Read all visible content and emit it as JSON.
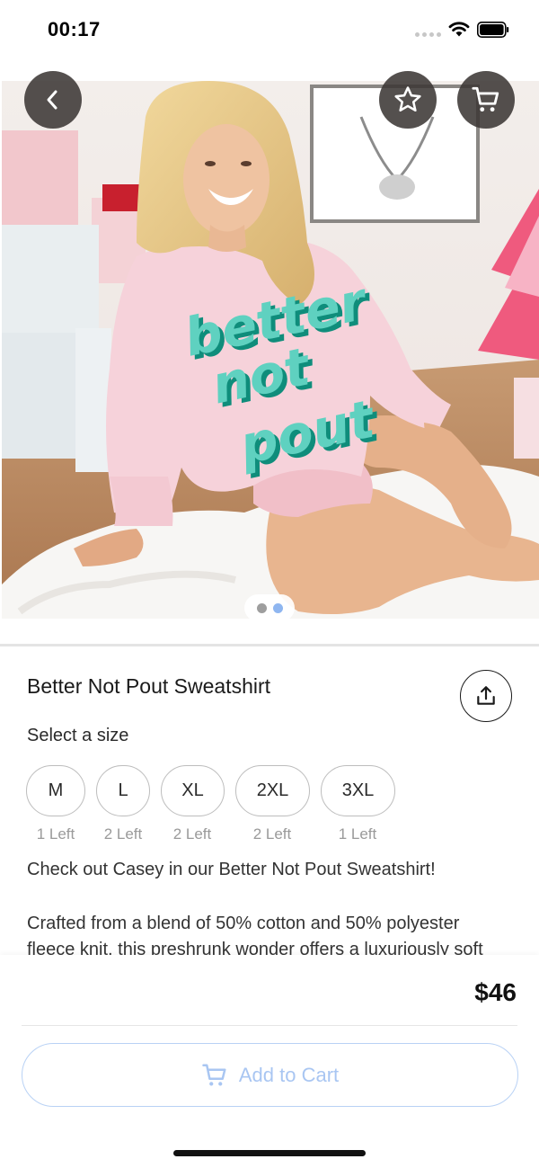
{
  "status_bar": {
    "time": "00:17",
    "wifi_icon": "wifi-icon",
    "battery_icon": "battery-icon"
  },
  "header": {
    "back_icon": "chevron-left-icon",
    "favorite_icon": "star-icon",
    "cart_icon": "cart-icon",
    "button_bg": "#3c3836"
  },
  "gallery": {
    "shirt_text": [
      "better",
      "not",
      "pout"
    ],
    "pages": 2,
    "active_page": 2
  },
  "product": {
    "title": "Better Not Pout Sweatshirt",
    "share_icon": "share-icon",
    "size_label": "Select a size",
    "sizes": [
      {
        "label": "M",
        "stock": "1 Left"
      },
      {
        "label": "L",
        "stock": "2 Left"
      },
      {
        "label": "XL",
        "stock": "2 Left"
      },
      {
        "label": "2XL",
        "stock": "2 Left"
      },
      {
        "label": "3XL",
        "stock": "1 Left"
      }
    ],
    "description_lines": [
      "Check out Casey in our Better Not Pout Sweatshirt!",
      "Crafted from a blend of 50% cotton and 50% polyester",
      "fleece knit, this preshrunk wonder offers a luxuriously soft"
    ]
  },
  "checkout": {
    "price": "$46",
    "add_to_cart_label": "Add to Cart",
    "add_to_cart_icon": "cart-icon",
    "accent_color": "#a9c6f2"
  }
}
